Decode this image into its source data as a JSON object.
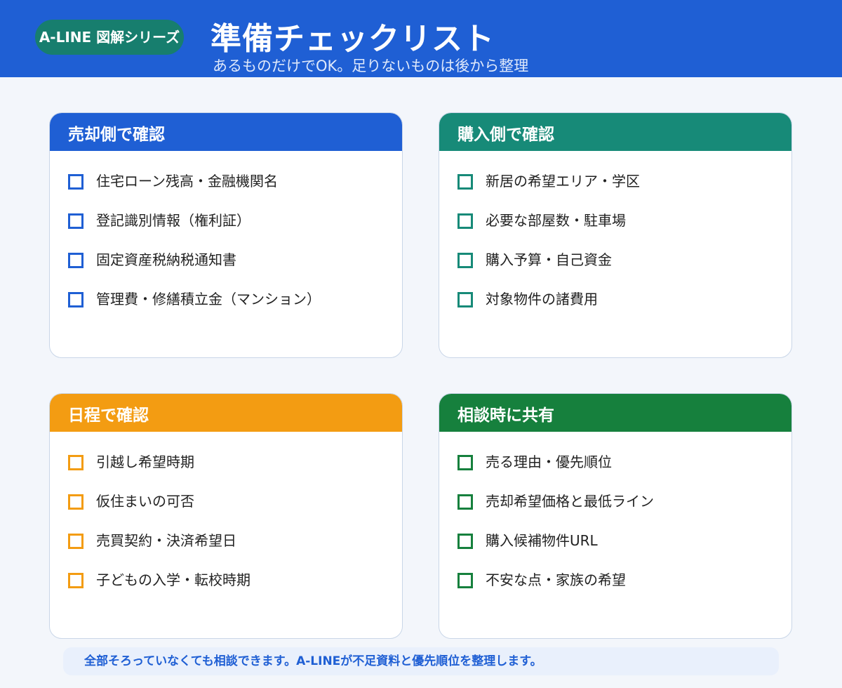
{
  "header": {
    "series_label": "A-LINE 図解シリーズ",
    "title": "準備チェックリスト",
    "subtitle": "あるものだけでOK。足りないものは後から整理",
    "color": "#1f5fd4",
    "pill_color": "#177e6e"
  },
  "cards": [
    {
      "title": "売却側で確認",
      "color": "#1f5fd4",
      "items": [
        "住宅ローン残高・金融機関名",
        "登記識別情報（権利証）",
        "固定資産税納税通知書",
        "管理費・修繕積立金（マンション）"
      ]
    },
    {
      "title": "購入側で確認",
      "color": "#178a78",
      "items": [
        "新居の希望エリア・学区",
        "必要な部屋数・駐車場",
        "購入予算・自己資金",
        "対象物件の諸費用"
      ]
    },
    {
      "title": "日程で確認",
      "color": "#f39c12",
      "items": [
        "引越し希望時期",
        "仮住まいの可否",
        "売買契約・決済希望日",
        "子どもの入学・転校時期"
      ]
    },
    {
      "title": "相談時に共有",
      "color": "#16803d",
      "items": [
        "売る理由・優先順位",
        "売却希望価格と最低ライン",
        "購入候補物件URL",
        "不安な点・家族の希望"
      ]
    }
  ],
  "footer": {
    "note": "全部そろっていなくても相談できます。A-LINEが不足資料と優先順位を整理します。"
  }
}
